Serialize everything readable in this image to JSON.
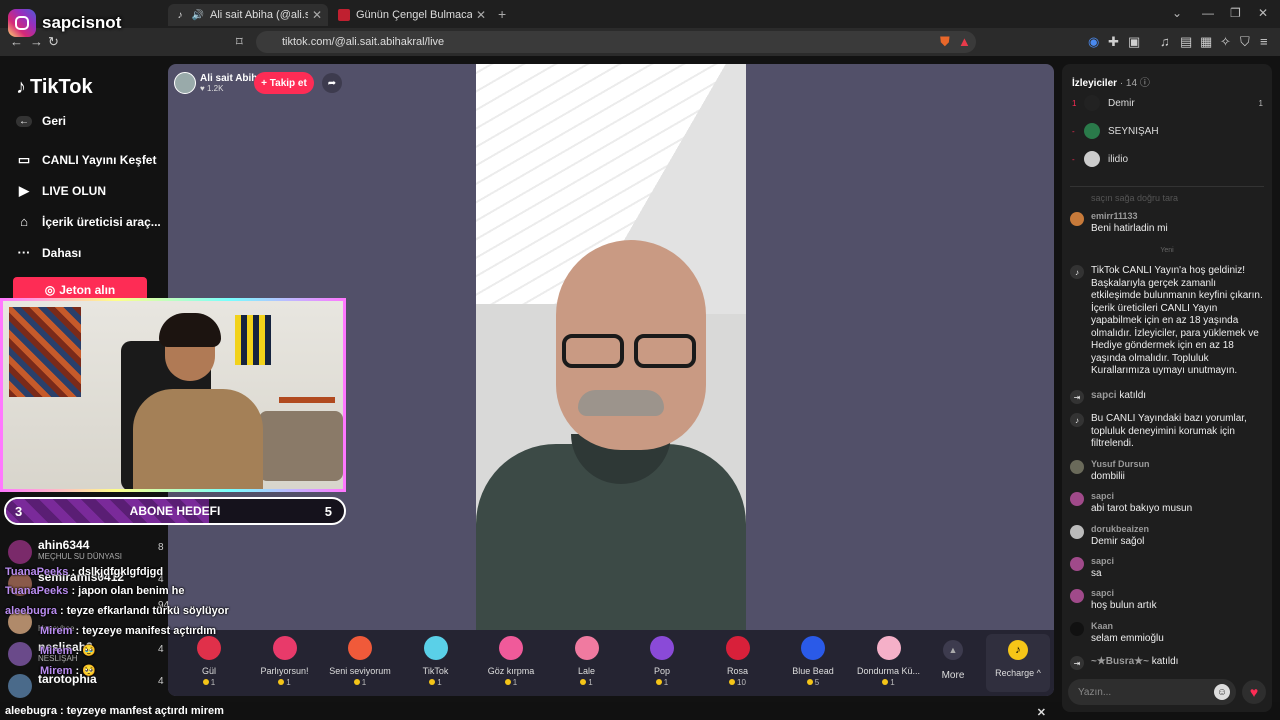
{
  "browser": {
    "tabs": [
      {
        "title": "Ali sait Abiha (@ali.sait.abihal",
        "active": true
      },
      {
        "title": "Günün Çengel Bulmacası| HT Bulmac",
        "active": false
      }
    ],
    "url": "tiktok.com/@ali.sait.abihakral/live"
  },
  "instagram_overlay": {
    "handle": "sapcisnot"
  },
  "sidebar": {
    "logo": "TikTok",
    "items": [
      {
        "label": "Geri",
        "icon": "back-arrow-icon"
      },
      {
        "label": "CANLI Yayını Keşfet",
        "icon": "live-tv-icon"
      },
      {
        "label": "LIVE OLUN",
        "icon": "video-camera-icon"
      },
      {
        "label": "İçerik üreticisi araç...",
        "icon": "lightbulb-icon"
      },
      {
        "label": "Dahası",
        "icon": "more-dots-icon"
      }
    ],
    "coin_button": "Jeton alın"
  },
  "goal": {
    "left": "3",
    "title": "ABONE HEDEFI",
    "right": "5",
    "progress": 0.6
  },
  "leaderboard": [
    {
      "name": "ahin6344",
      "sub": "MEÇHUL SU DÜNYASI",
      "count": "8"
    },
    {
      "name": "semiramis0412",
      "sub": "",
      "count": "4"
    },
    {
      "name": "Honeybee",
      "sub": "Honeybee",
      "count": "94"
    },
    {
      "name": "neslisah3",
      "sub": "NESLİŞAH",
      "count": "4"
    },
    {
      "name": "tarotophia",
      "sub": "",
      "count": "4"
    }
  ],
  "overlay_chat": [
    {
      "who": "TuanaPeeks",
      "msg": " : dslkjdfgklgfdjgd"
    },
    {
      "who": "TuanaPeeks",
      "msg": " : japon olan benim he"
    },
    {
      "who": "aleebugra",
      "msg": " : teyze efkarlandı türkü söylüyor"
    },
    {
      "who": "Mirem",
      "msg": " : teyzeye manifest açtırdım"
    },
    {
      "who": "Mirem",
      "msg": " : 🥹"
    },
    {
      "who": "Mirem",
      "msg": " : 🥺"
    }
  ],
  "banner": "aleebugra : teyzeye manfest açtırdı mirem",
  "stream": {
    "host_name": "Ali sait Abiha",
    "host_likes": "♥ 1.2K",
    "follow": "+ Takip et"
  },
  "gifts": [
    {
      "name": "Gül",
      "price": "1",
      "color": "#e0304a"
    },
    {
      "name": "Parlıyorsun!",
      "price": "1",
      "color": "#e83a6a"
    },
    {
      "name": "Seni seviyorum",
      "price": "1",
      "color": "#f05a3a"
    },
    {
      "name": "TikTok",
      "price": "1",
      "color": "#5ad0e8"
    },
    {
      "name": "Göz kırpma",
      "price": "1",
      "color": "#f05a9a"
    },
    {
      "name": "Lale",
      "price": "1",
      "color": "#f07aa0"
    },
    {
      "name": "Pop",
      "price": "1",
      "color": "#8a4ad8"
    },
    {
      "name": "Rosa",
      "price": "10",
      "color": "#d8203a"
    },
    {
      "name": "Blue Bead",
      "price": "5",
      "color": "#2a5ae8"
    },
    {
      "name": "Dondurma Kü...",
      "price": "1",
      "color": "#f5b0c8"
    }
  ],
  "more_label": "More",
  "recharge_label": "Recharge ^",
  "chat": {
    "viewers_title": "İzleyiciler",
    "viewers_count": "· 14",
    "viewers": [
      {
        "rank": "1",
        "name": "Demir",
        "score": "1",
        "color": "#222"
      },
      {
        "rank": "-",
        "name": "SEYNIŞAH",
        "score": "",
        "color": "#2a7a4a"
      },
      {
        "rank": "-",
        "name": "ilidio",
        "score": "",
        "color": "#ccc"
      }
    ],
    "faded_msg": "saçın sağa doğru tara",
    "new_label": "Yeni",
    "messages": [
      {
        "user": "emirr11133",
        "text": "Beni hatirladin mi",
        "color": "#c77a3a",
        "kind": "user"
      },
      {
        "user": "",
        "text": "TikTok CANLI Yayın'a hoş geldiniz! Başkalarıyla gerçek zamanlı etkileşimde bulunmanın keyfini çıkarın. İçerik üreticileri CANLI Yayın yapabilmek için en az 18 yaşında olmalıdır. İzleyiciler, para yüklemek ve Hediye göndermek için en az 18 yaşında olmalıdır. Topluluk Kurallarımıza uymayı unutmayın.",
        "color": "#333",
        "kind": "system"
      },
      {
        "user": "sapci",
        "text": "katıldı",
        "color": "#333",
        "kind": "join"
      },
      {
        "user": "",
        "text": "Bu CANLI Yayındaki bazı yorumlar, topluluk deneyimini korumak için filtrelendi.",
        "color": "#333",
        "kind": "system"
      },
      {
        "user": "Yusuf Dursun",
        "text": "dombilii",
        "color": "#6a6a5a",
        "kind": "user"
      },
      {
        "user": "sapci",
        "text": "abi tarot bakıyo musun",
        "color": "#a04a8a",
        "kind": "user"
      },
      {
        "user": "dorukbeaizen",
        "text": "Demir sağol",
        "color": "#bbb",
        "kind": "user"
      },
      {
        "user": "sapci",
        "text": "sa",
        "color": "#a04a8a",
        "kind": "user"
      },
      {
        "user": "sapci",
        "text": "hoş bulun artık",
        "color": "#a04a8a",
        "kind": "user"
      },
      {
        "user": "Kaan",
        "text": "selam emmioğlu",
        "color": "#111",
        "kind": "user"
      },
      {
        "user": "~★Busra★~",
        "text": "katıldı",
        "color": "#333",
        "kind": "join"
      }
    ],
    "input_placeholder": "Yazın..."
  }
}
